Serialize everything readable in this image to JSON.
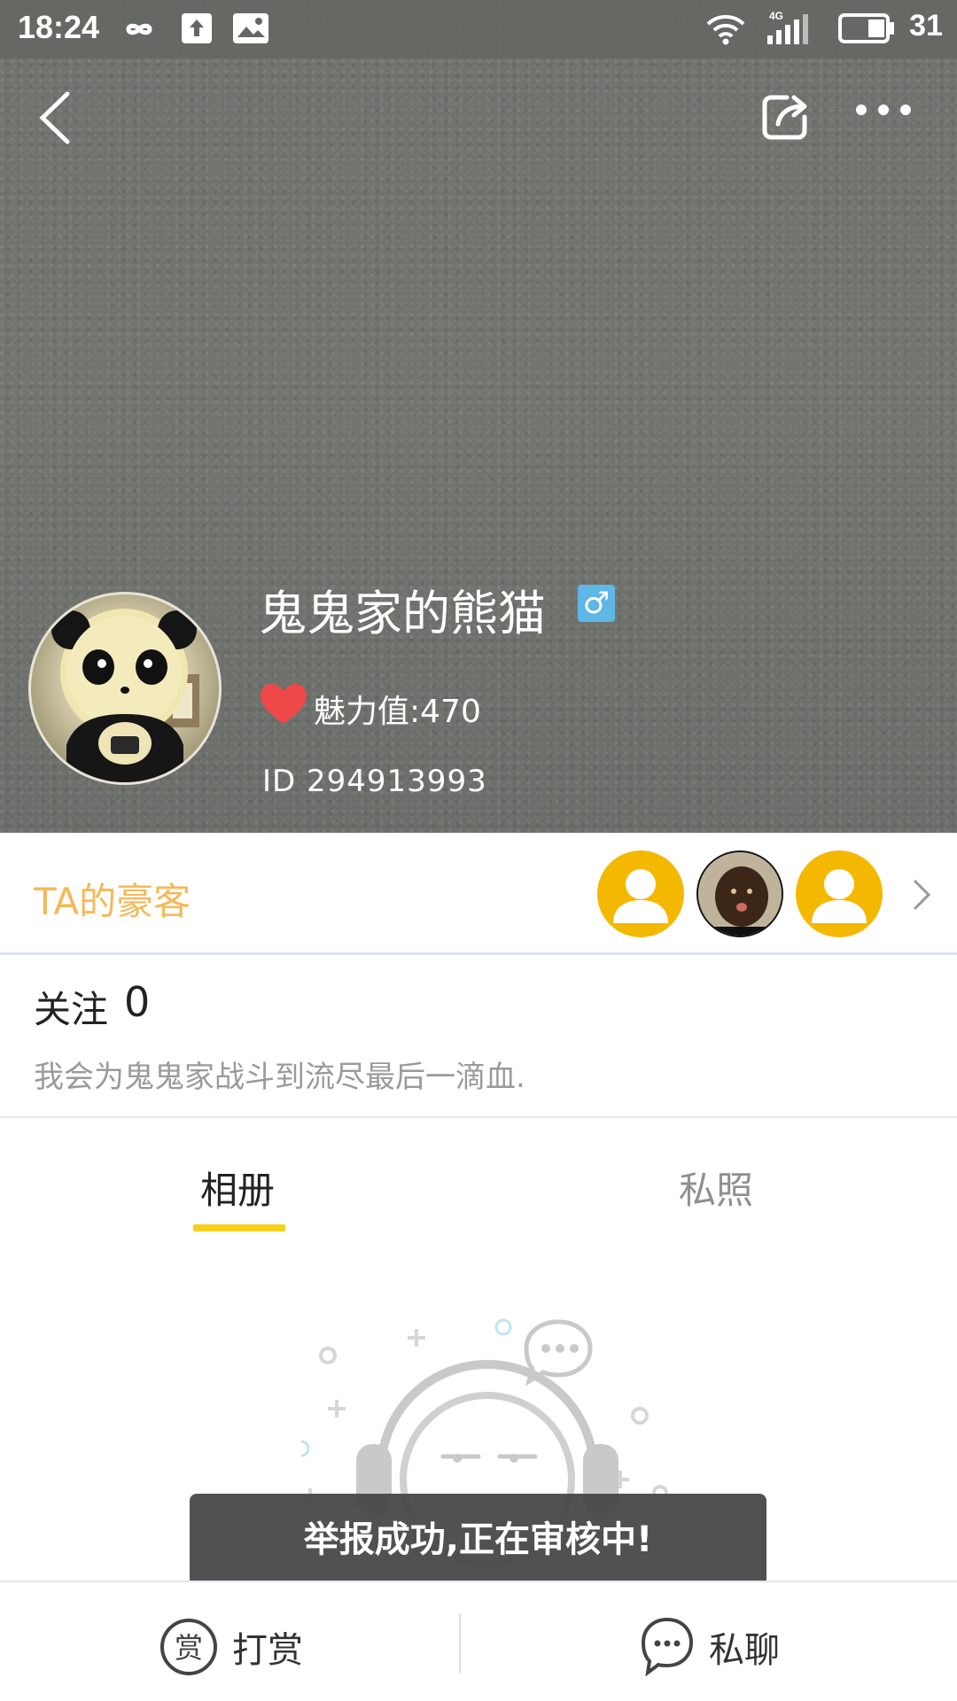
{
  "status_bar": {
    "time": "18:24",
    "battery": "31",
    "icons": [
      "infinity-icon",
      "upload-icon",
      "image-icon",
      "wifi-icon",
      "signal-4g-icon",
      "battery-icon"
    ]
  },
  "nav": {
    "back_icon": "chevron-left-icon",
    "share_icon": "share-icon",
    "more_icon": "more-dots-icon"
  },
  "profile": {
    "username": "鬼鬼家的熊猫",
    "gender_symbol": "♂",
    "gender_color": "#5eb7e6",
    "charm": "魅力值:470",
    "id_text": "ID  294913993"
  },
  "patrons": {
    "label": "TA的豪客",
    "label_color": "#f4b95a",
    "avatars": [
      "default-user-avatar",
      "photo-avatar",
      "default-user-avatar"
    ]
  },
  "follow": {
    "label": "关注",
    "count": "0",
    "bio": "我会为鬼鬼家战斗到流尽最后一滴血."
  },
  "tabs": [
    {
      "label": "相册",
      "active": true
    },
    {
      "label": "私照",
      "active": false
    }
  ],
  "accent_color": "#f7cf1a",
  "toast": "举报成功,正在审核中!",
  "bottom_bar": {
    "reward_label": "打赏",
    "reward_icon_text": "赏",
    "chat_label": "私聊"
  }
}
